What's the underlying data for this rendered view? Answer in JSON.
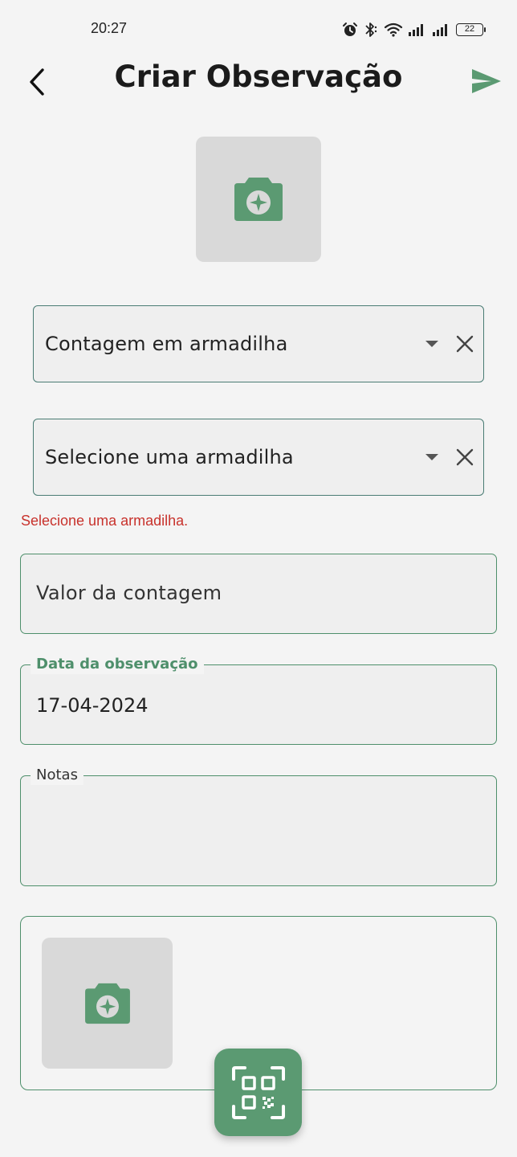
{
  "status_bar": {
    "time": "20:27",
    "battery": "22",
    "icons": [
      "alarm-icon",
      "bluetooth-icon",
      "wifi-icon",
      "signal-icon",
      "signal-icon",
      "battery-icon"
    ]
  },
  "header": {
    "title": "Criar Observação",
    "back_icon": "chevron-left-icon",
    "send_icon": "send-icon"
  },
  "form": {
    "observation_type": {
      "value": "Contagem em armadilha"
    },
    "trap": {
      "value": "Selecione uma armadilha",
      "error": "Selecione uma armadilha."
    },
    "count_value": {
      "placeholder": "Valor da contagem"
    },
    "date": {
      "label": "Data da observação",
      "value": "17-04-2024"
    },
    "notes": {
      "label": "Notas",
      "value": ""
    }
  },
  "colors": {
    "accent": "#5b9a72",
    "error": "#c8322c",
    "field_border": "#4e8f6b",
    "placeholder_bg": "#d9d9d9"
  }
}
